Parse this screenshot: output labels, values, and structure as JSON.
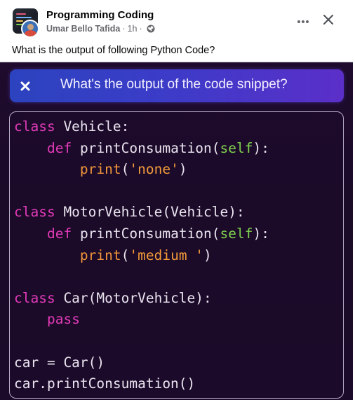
{
  "post": {
    "group_name": "Programming Coding",
    "author": "Umar Bello Tafida",
    "time": "1h",
    "separator": "·",
    "caption": "What is the output of following Python Code?",
    "icons": {
      "more": "more-options-icon",
      "close": "close-icon",
      "privacy": "globe-icon"
    }
  },
  "media": {
    "prompt": "What's the output of the code snippet?",
    "prompt_icon": "close-x-icon",
    "colors": {
      "background": "#1e0b2d",
      "prompt_gradient_start": "#2c43bf",
      "prompt_gradient_end": "#5b2fc9",
      "keyword": "#e23bb8",
      "self": "#7ed14e",
      "builtin": "#f0953a",
      "text": "#e9e4ef"
    },
    "code_lines": [
      [
        {
          "t": "class",
          "c": "kw"
        },
        {
          "t": " Vehicle:",
          "c": ""
        }
      ],
      [
        {
          "t": "    ",
          "c": ""
        },
        {
          "t": "def",
          "c": "kw"
        },
        {
          "t": " printConsumation(",
          "c": ""
        },
        {
          "t": "self",
          "c": "self"
        },
        {
          "t": "):",
          "c": ""
        }
      ],
      [
        {
          "t": "        ",
          "c": ""
        },
        {
          "t": "print",
          "c": "fn-print"
        },
        {
          "t": "(",
          "c": ""
        },
        {
          "t": "'none'",
          "c": "str"
        },
        {
          "t": ")",
          "c": ""
        }
      ],
      [],
      [
        {
          "t": "class",
          "c": "kw"
        },
        {
          "t": " MotorVehicle(Vehicle):",
          "c": ""
        }
      ],
      [
        {
          "t": "    ",
          "c": ""
        },
        {
          "t": "def",
          "c": "kw"
        },
        {
          "t": " printConsumation(",
          "c": ""
        },
        {
          "t": "self",
          "c": "self"
        },
        {
          "t": "):",
          "c": ""
        }
      ],
      [
        {
          "t": "        ",
          "c": ""
        },
        {
          "t": "print",
          "c": "fn-print"
        },
        {
          "t": "(",
          "c": ""
        },
        {
          "t": "'medium '",
          "c": "str"
        },
        {
          "t": ")",
          "c": ""
        }
      ],
      [],
      [
        {
          "t": "class",
          "c": "kw"
        },
        {
          "t": " Car(MotorVehicle):",
          "c": ""
        }
      ],
      [
        {
          "t": "    ",
          "c": ""
        },
        {
          "t": "pass",
          "c": "kw"
        }
      ],
      [],
      [
        {
          "t": "car = Car()",
          "c": ""
        }
      ],
      [
        {
          "t": "car.printConsumation()",
          "c": ""
        }
      ]
    ]
  }
}
